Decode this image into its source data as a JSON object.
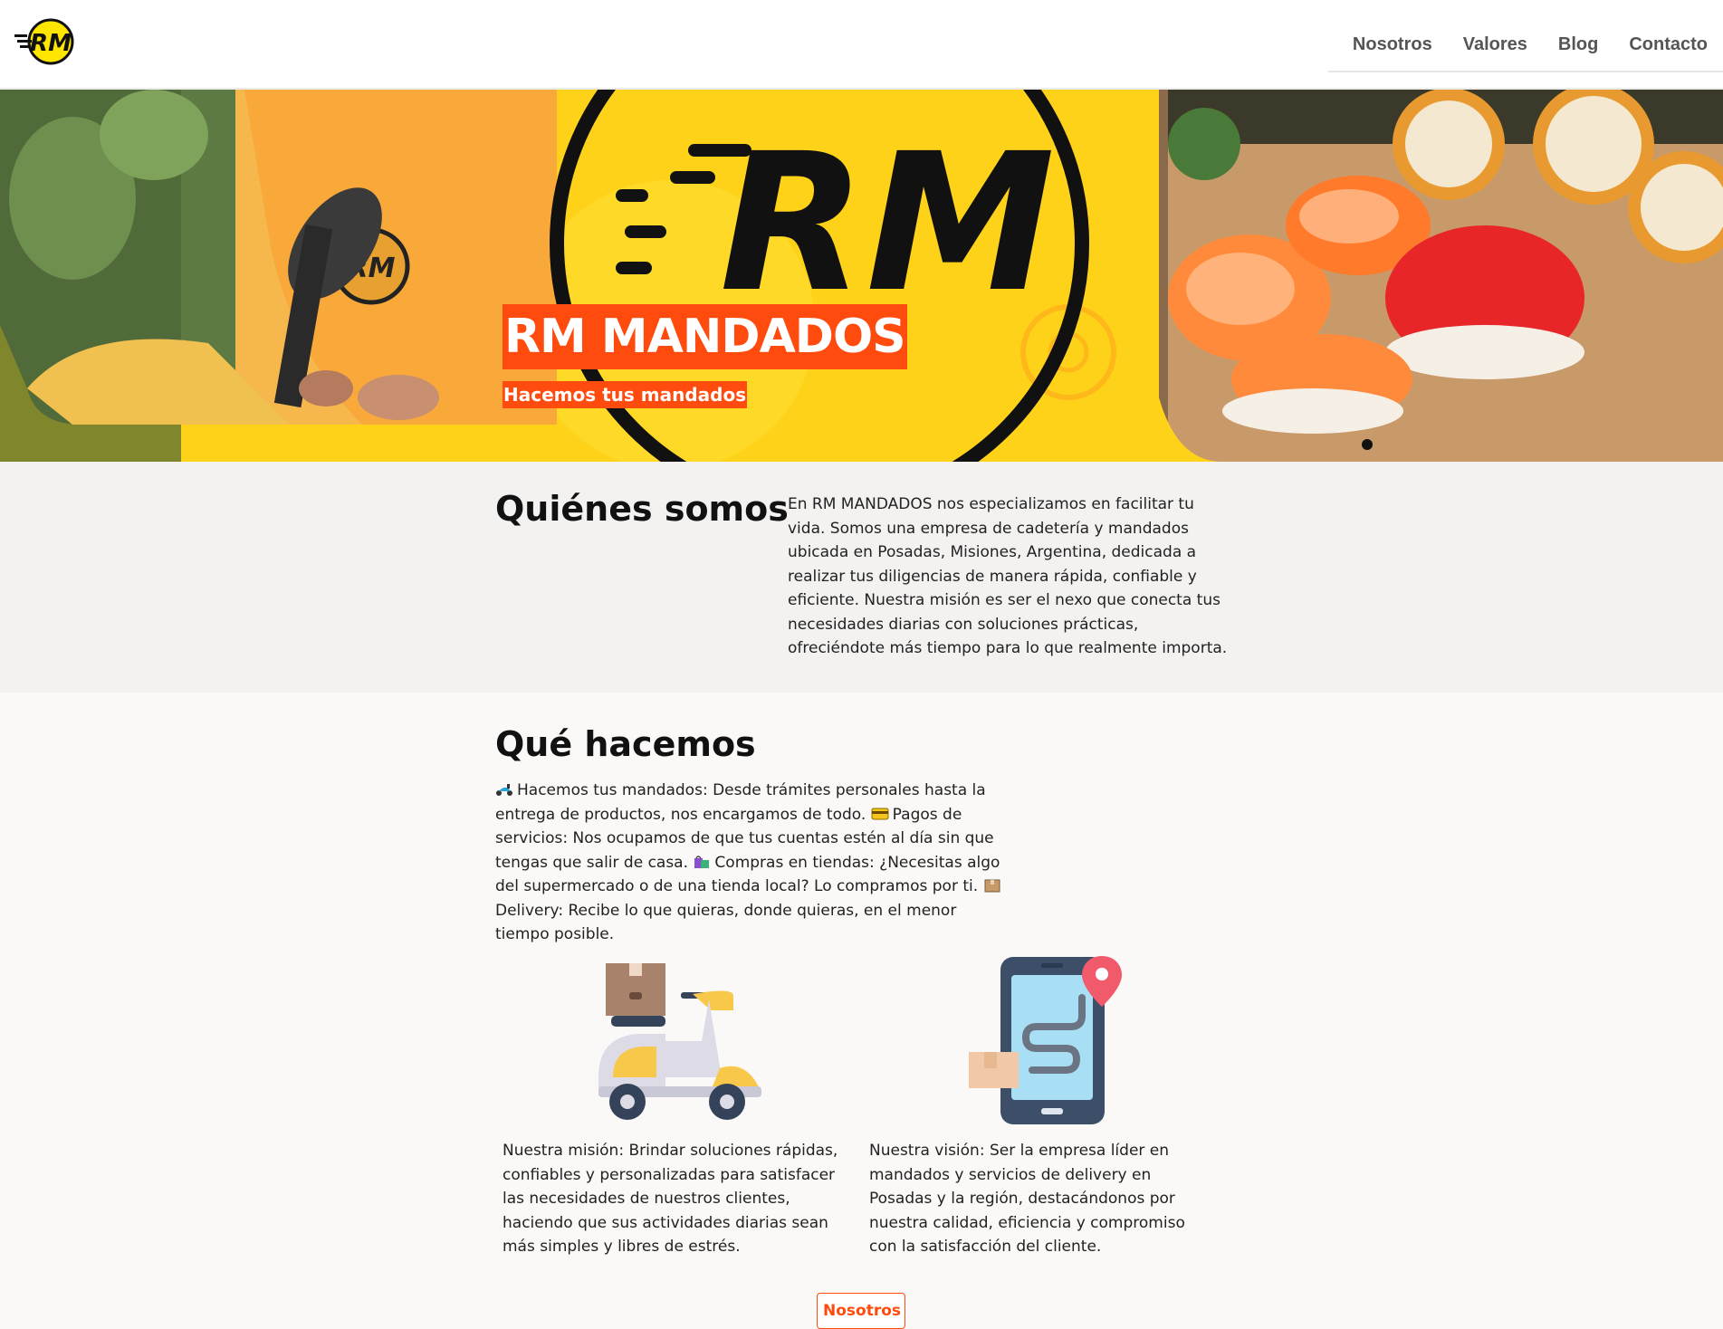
{
  "header": {
    "logo_text": "RM",
    "nav": [
      "Nosotros",
      "Valores",
      "Blog",
      "Contacto"
    ]
  },
  "hero": {
    "title": "RM MANDADOS",
    "subtitle": "Hacemos tus mandados",
    "logo_text": "RM"
  },
  "about": {
    "heading": "Quiénes somos",
    "body": "En RM MANDADOS nos especializamos en facilitar tu vida. Somos una empresa de cadetería y mandados ubicada en Posadas, Misiones, Argentina, dedicada a realizar tus diligencias de manera rápida, confiable y eficiente. Nuestra misión es ser el nexo que conecta tus necesidades diarias con soluciones prácticas, ofreciéndote más tiempo para lo que realmente importa."
  },
  "what": {
    "heading": "Qué hacemos",
    "items": [
      "Hacemos tus mandados: Desde trámites personales hasta la entrega de productos, nos encargamos de todo.",
      "Pagos de servicios: Nos ocupamos de que tus cuentas estén al día sin que tengas que salir de casa.",
      "Compras en tiendas: ¿Necesitas algo del supermercado o de una tienda local? Lo compramos por ti.",
      "Delivery: Recibe lo que quieras, donde quieras, en el menor tiempo posible."
    ],
    "item_icons": [
      "scooter-icon",
      "credit-card-icon",
      "shopping-bags-icon",
      "package-icon"
    ],
    "mission": "Nuestra misión: Brindar soluciones rápidas, confiables y personalizadas para satisfacer las necesidades de nuestros clientes, haciendo que sus actividades diarias sean más simples y libres de estrés.",
    "vision": "Nuestra visión: Ser la empresa líder en mandados y servicios de delivery en Posadas y la región, destacándonos por nuestra calidad, eficiencia y compromiso con la satisfacción del cliente.",
    "button": "Nosotros"
  },
  "colors": {
    "accent": "#ff4b0e",
    "brand_yellow": "#ffd41f",
    "about_bg": "#f3f2f1",
    "page_bg": "#fbf9f7"
  }
}
